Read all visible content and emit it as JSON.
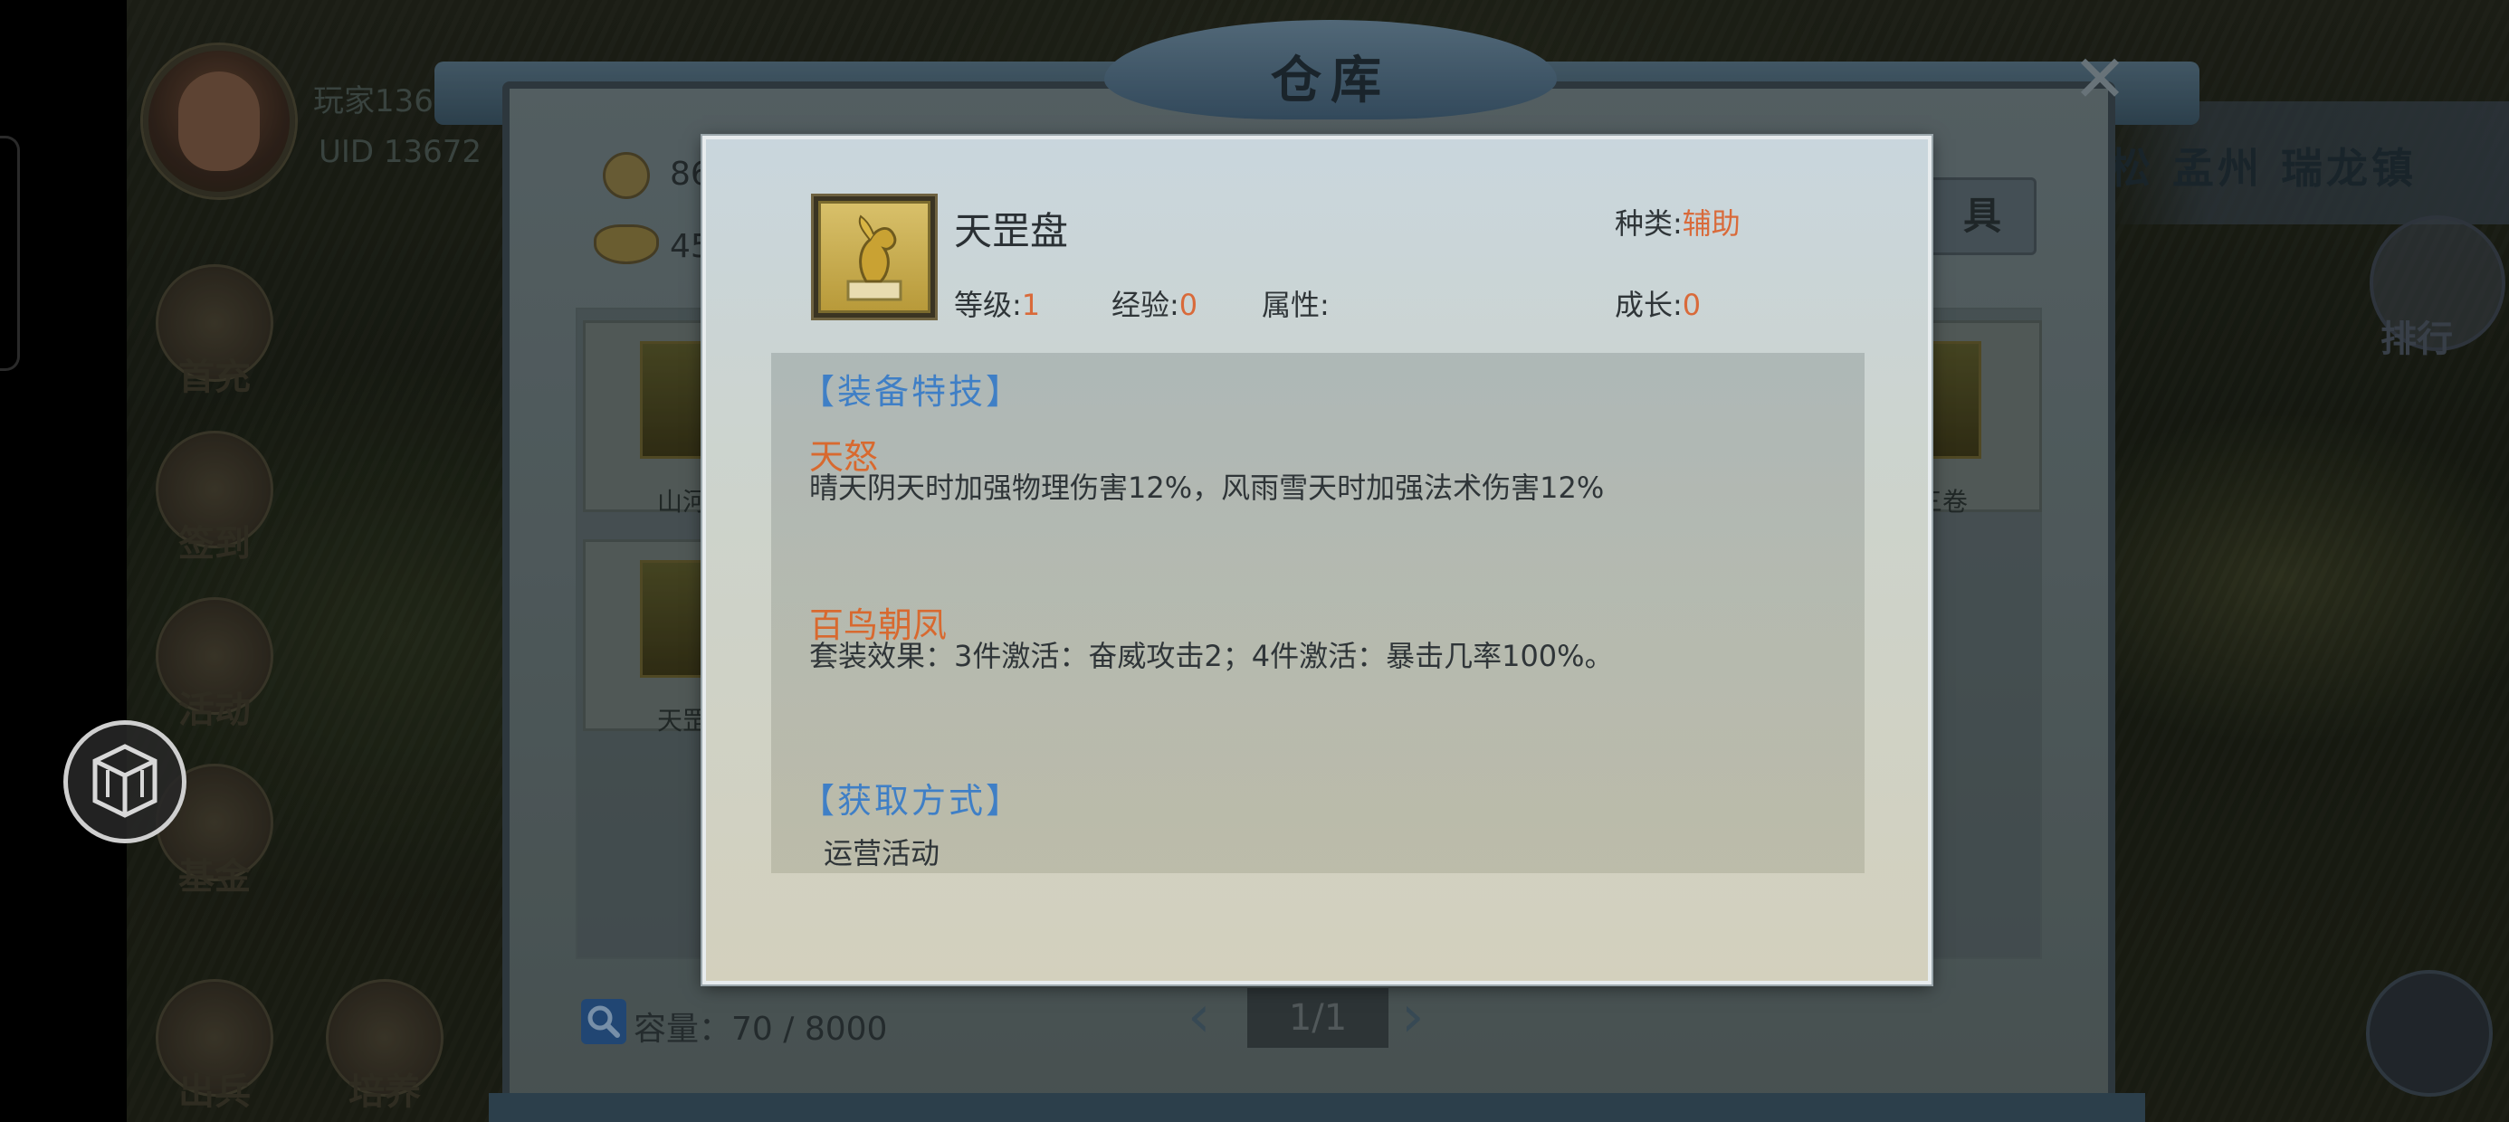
{
  "player": {
    "name": "玩家136",
    "uid": "UID 13672"
  },
  "side_menu": [
    {
      "key": "first_charge",
      "label": "首充"
    },
    {
      "key": "sign_in",
      "label": "签到"
    },
    {
      "key": "events",
      "label": "活动"
    },
    {
      "key": "fund",
      "label": "基金"
    },
    {
      "key": "dispatch",
      "label": "出兵"
    },
    {
      "key": "cultivate",
      "label": "培养"
    }
  ],
  "header": {
    "location": "松 孟州 瑞龙镇",
    "rank_label": "排行"
  },
  "warehouse": {
    "title": "仓库",
    "close_symbol": "✕",
    "currency": [
      {
        "icon": "coin-icon",
        "amount": "86"
      },
      {
        "icon": "ingot-icon",
        "amount": "45"
      }
    ],
    "tab_label": "具",
    "slots": [
      {
        "label": "山河"
      },
      {
        "label": "三卷"
      },
      {
        "label": "天罡"
      }
    ],
    "capacity": "容量：70 / 8000",
    "page": "1/1"
  },
  "tooltip": {
    "item_name": "天罡盘",
    "category_label": "种类:",
    "category_value": "辅助",
    "level_label": "等级:",
    "level_value": "1",
    "exp_label": "经验:",
    "exp_value": "0",
    "attr_label": "属性:",
    "growth_label": "成长:",
    "growth_value": "0",
    "skills_title": "【装备特技】",
    "skills": [
      {
        "name": "天怒",
        "desc": "晴天阴天时加强物理伤害12%，风雨雪天时加强法术伤害12%"
      },
      {
        "name": "百鸟朝凤",
        "desc": "套装效果：3件激活：奋威攻击2；4件激活：暴击几率100%。"
      }
    ],
    "source_title": "【获取方式】",
    "source": "运营活动"
  },
  "colors": {
    "accent_blue": "#3f7fc6",
    "value_orange": "#d96a3a"
  }
}
